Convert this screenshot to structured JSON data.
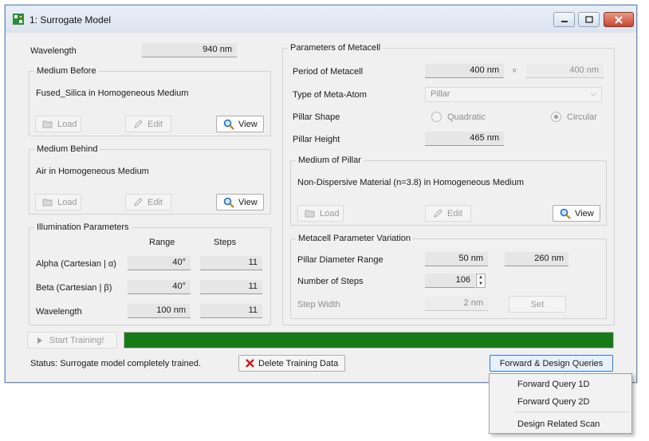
{
  "window": {
    "title": "1: Surrogate Model",
    "controls": {
      "minimize": "minimize-icon",
      "maximize": "maximize-icon",
      "close": "close-icon"
    }
  },
  "left": {
    "wavelength_label": "Wavelength",
    "wavelength_value": "940 nm",
    "medium_before": {
      "title": "Medium Before",
      "description": "Fused_Silica in Homogeneous Medium",
      "load": "Load",
      "edit": "Edit",
      "view": "View"
    },
    "medium_behind": {
      "title": "Medium Behind",
      "description": "Air in Homogeneous Medium",
      "load": "Load",
      "edit": "Edit",
      "view": "View"
    },
    "illumination": {
      "title": "Illumination Parameters",
      "col_range": "Range",
      "col_steps": "Steps",
      "rows": [
        {
          "label": "Alpha (Cartesian | α)",
          "range": "40°",
          "steps": "11"
        },
        {
          "label": "Beta (Cartesian | β)",
          "range": "40°",
          "steps": "11"
        },
        {
          "label": "Wavelength",
          "range": "100 nm",
          "steps": "11"
        }
      ]
    }
  },
  "right": {
    "title": "Parameters of Metacell",
    "period_label": "Period of Metacell",
    "period_x": "400 nm",
    "period_times": "×",
    "period_y": "400 nm",
    "meta_atom_label": "Type of Meta-Atom",
    "meta_atom_value": "Pillar",
    "pillar_shape_label": "Pillar Shape",
    "shape_quadratic": "Quadratic",
    "shape_circular": "Circular",
    "pillar_height_label": "Pillar Height",
    "pillar_height_value": "465 nm",
    "medium_of_pillar": {
      "title": "Medium of Pillar",
      "description": "Non-Dispersive Material (n=3.8) in Homogeneous Medium",
      "load": "Load",
      "edit": "Edit",
      "view": "View"
    },
    "variation": {
      "title": "Metacell Parameter Variation",
      "diameter_label": "Pillar Diameter Range",
      "diameter_min": "50 nm",
      "diameter_max": "260 nm",
      "steps_label": "Number of Steps",
      "steps_value": "106",
      "stepwidth_label": "Step Width",
      "stepwidth_value": "2 nm",
      "set": "Set"
    }
  },
  "bottom": {
    "start_training": "Start Training!",
    "progress": 1.0,
    "progress_color": "#177a17",
    "status": "Status: Surrogate model completely trained.",
    "delete_training": "Delete Training Data",
    "queries_button": "Forward & Design Queries"
  },
  "menu": {
    "items": [
      "Forward Query 1D",
      "Forward Query 2D",
      "Design Related Scan"
    ]
  }
}
